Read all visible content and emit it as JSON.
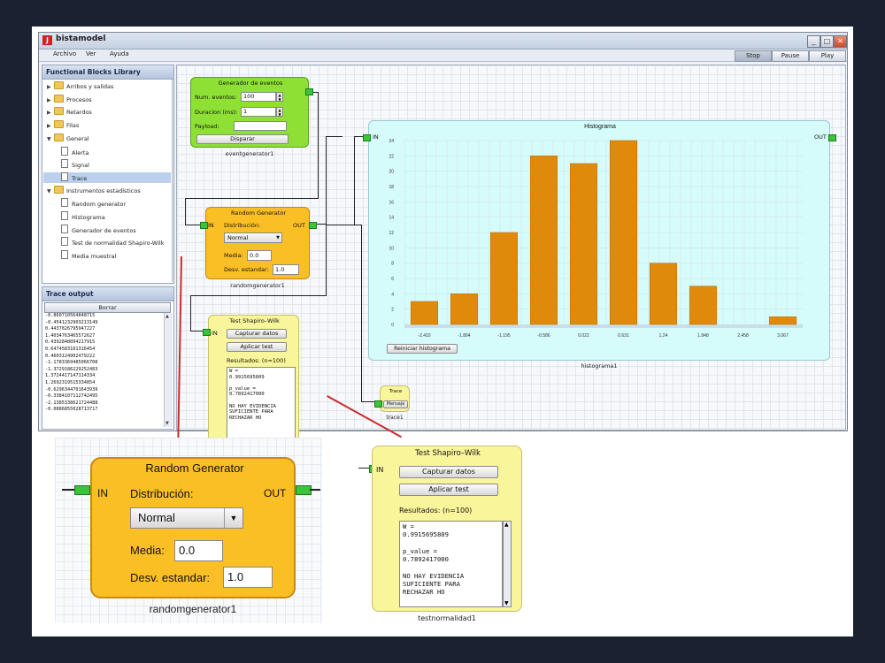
{
  "app": {
    "title": "bistamodel",
    "menu": [
      "Archivo",
      "Ver",
      "Ayuda"
    ],
    "run_controls": [
      "Stop",
      "Pause",
      "Play"
    ],
    "window_buttons": [
      "_",
      "□",
      "✕"
    ]
  },
  "library": {
    "title": "Functional Blocks Library",
    "items": [
      {
        "label": "Arribos y salidas",
        "type": "folder",
        "expanded": false
      },
      {
        "label": "Procesos",
        "type": "folder",
        "expanded": false
      },
      {
        "label": "Retardos",
        "type": "folder",
        "expanded": false
      },
      {
        "label": "Filas",
        "type": "folder",
        "expanded": false
      },
      {
        "label": "General",
        "type": "folder",
        "expanded": true
      },
      {
        "label": "Alerta",
        "type": "doc"
      },
      {
        "label": "Signal",
        "type": "doc"
      },
      {
        "label": "Trace",
        "type": "doc",
        "selected": true
      },
      {
        "label": "Instrumentos estadísticos",
        "type": "folder",
        "expanded": true
      },
      {
        "label": "Random generator",
        "type": "doc"
      },
      {
        "label": "Histograma",
        "type": "doc"
      },
      {
        "label": "Generador de eventos",
        "type": "doc"
      },
      {
        "label": "Test de normalidad Shapiro-Wilk",
        "type": "doc"
      },
      {
        "label": "Media muestral",
        "type": "doc"
      }
    ]
  },
  "trace_output": {
    "title": "Trace output",
    "clear_label": "Borrar",
    "lines": [
      "-0.860710564848715",
      "-0.4541232903213149",
      "0.4437826795947227",
      "1.4034763465572627",
      "0.4392848094217915",
      "0.6474583101316454",
      "0.4603124902479222",
      "-1.1783369485066708",
      "-1.3729186229252483",
      "1.3724417147114334",
      "1.2692319515334854",
      "-0.6296344701643939",
      "-0.3384107112742495",
      "-2.1385338621724488",
      "-0.0886855028713717"
    ]
  },
  "event_generator": {
    "title": "Generador de eventos",
    "num_events_label": "Num. eventos:",
    "num_events_value": "100",
    "duration_label": "Duracion (ms):",
    "duration_value": "1",
    "payload_label": "Payload:",
    "payload_value": "",
    "fire_label": "Disparar",
    "caption": "eventgenerator1"
  },
  "random_generator": {
    "title": "Random Generator",
    "in_label": "IN",
    "out_label": "OUT",
    "dist_label": "Distribución:",
    "dist_value": "Normal",
    "mean_label": "Media:",
    "mean_value": "0.0",
    "std_label": "Desv. estandar:",
    "std_value": "1.0",
    "caption": "randomgenerator1"
  },
  "shapiro": {
    "title": "Test Shapiro–Wilk",
    "in_label": "IN",
    "capture_label": "Capturar datos",
    "apply_label": "Aplicar test",
    "results_label": "Resultados: (n=100)",
    "results_text": "W =\n0.9915695809\n\np_value =\n0.7892417000\n\nNO HAY EVIDENCIA\nSUFICIENTE PARA\nRECHAZAR HO",
    "caption": "testnormalidad1"
  },
  "trace_block": {
    "title": "Trace",
    "message_label": "Mensaje",
    "caption": "trace1"
  },
  "histogram": {
    "title": "Histograma",
    "in_label": "IN",
    "out_label": "OUT",
    "reset_label": "Reiniciar histograma",
    "caption": "histograma1"
  },
  "chart_data": {
    "type": "bar",
    "title": "Histograma",
    "categories": [
      "-2.410",
      "-1.804",
      "-1.195",
      "-0.586",
      "0.022",
      "0.631",
      "1.24",
      "1.848",
      "2.458",
      "3.067"
    ],
    "values": [
      3,
      4,
      12,
      22,
      21,
      24,
      8,
      5,
      0,
      1
    ],
    "yticks": [
      "0",
      "2",
      "4",
      "6",
      "8",
      "10",
      "12",
      "14",
      "16",
      "18",
      "20",
      "22",
      "24"
    ],
    "ylim": [
      0,
      24
    ],
    "grid": true,
    "bar_color": "#e08a0b"
  },
  "colors": {
    "green_block": "#8ee034",
    "orange_block": "#fbbf26",
    "yellow_block": "#f9f59a",
    "cyan_block": "#d6fbfb",
    "port": "#3ac43a",
    "callout_line": "#cc2b2b"
  }
}
